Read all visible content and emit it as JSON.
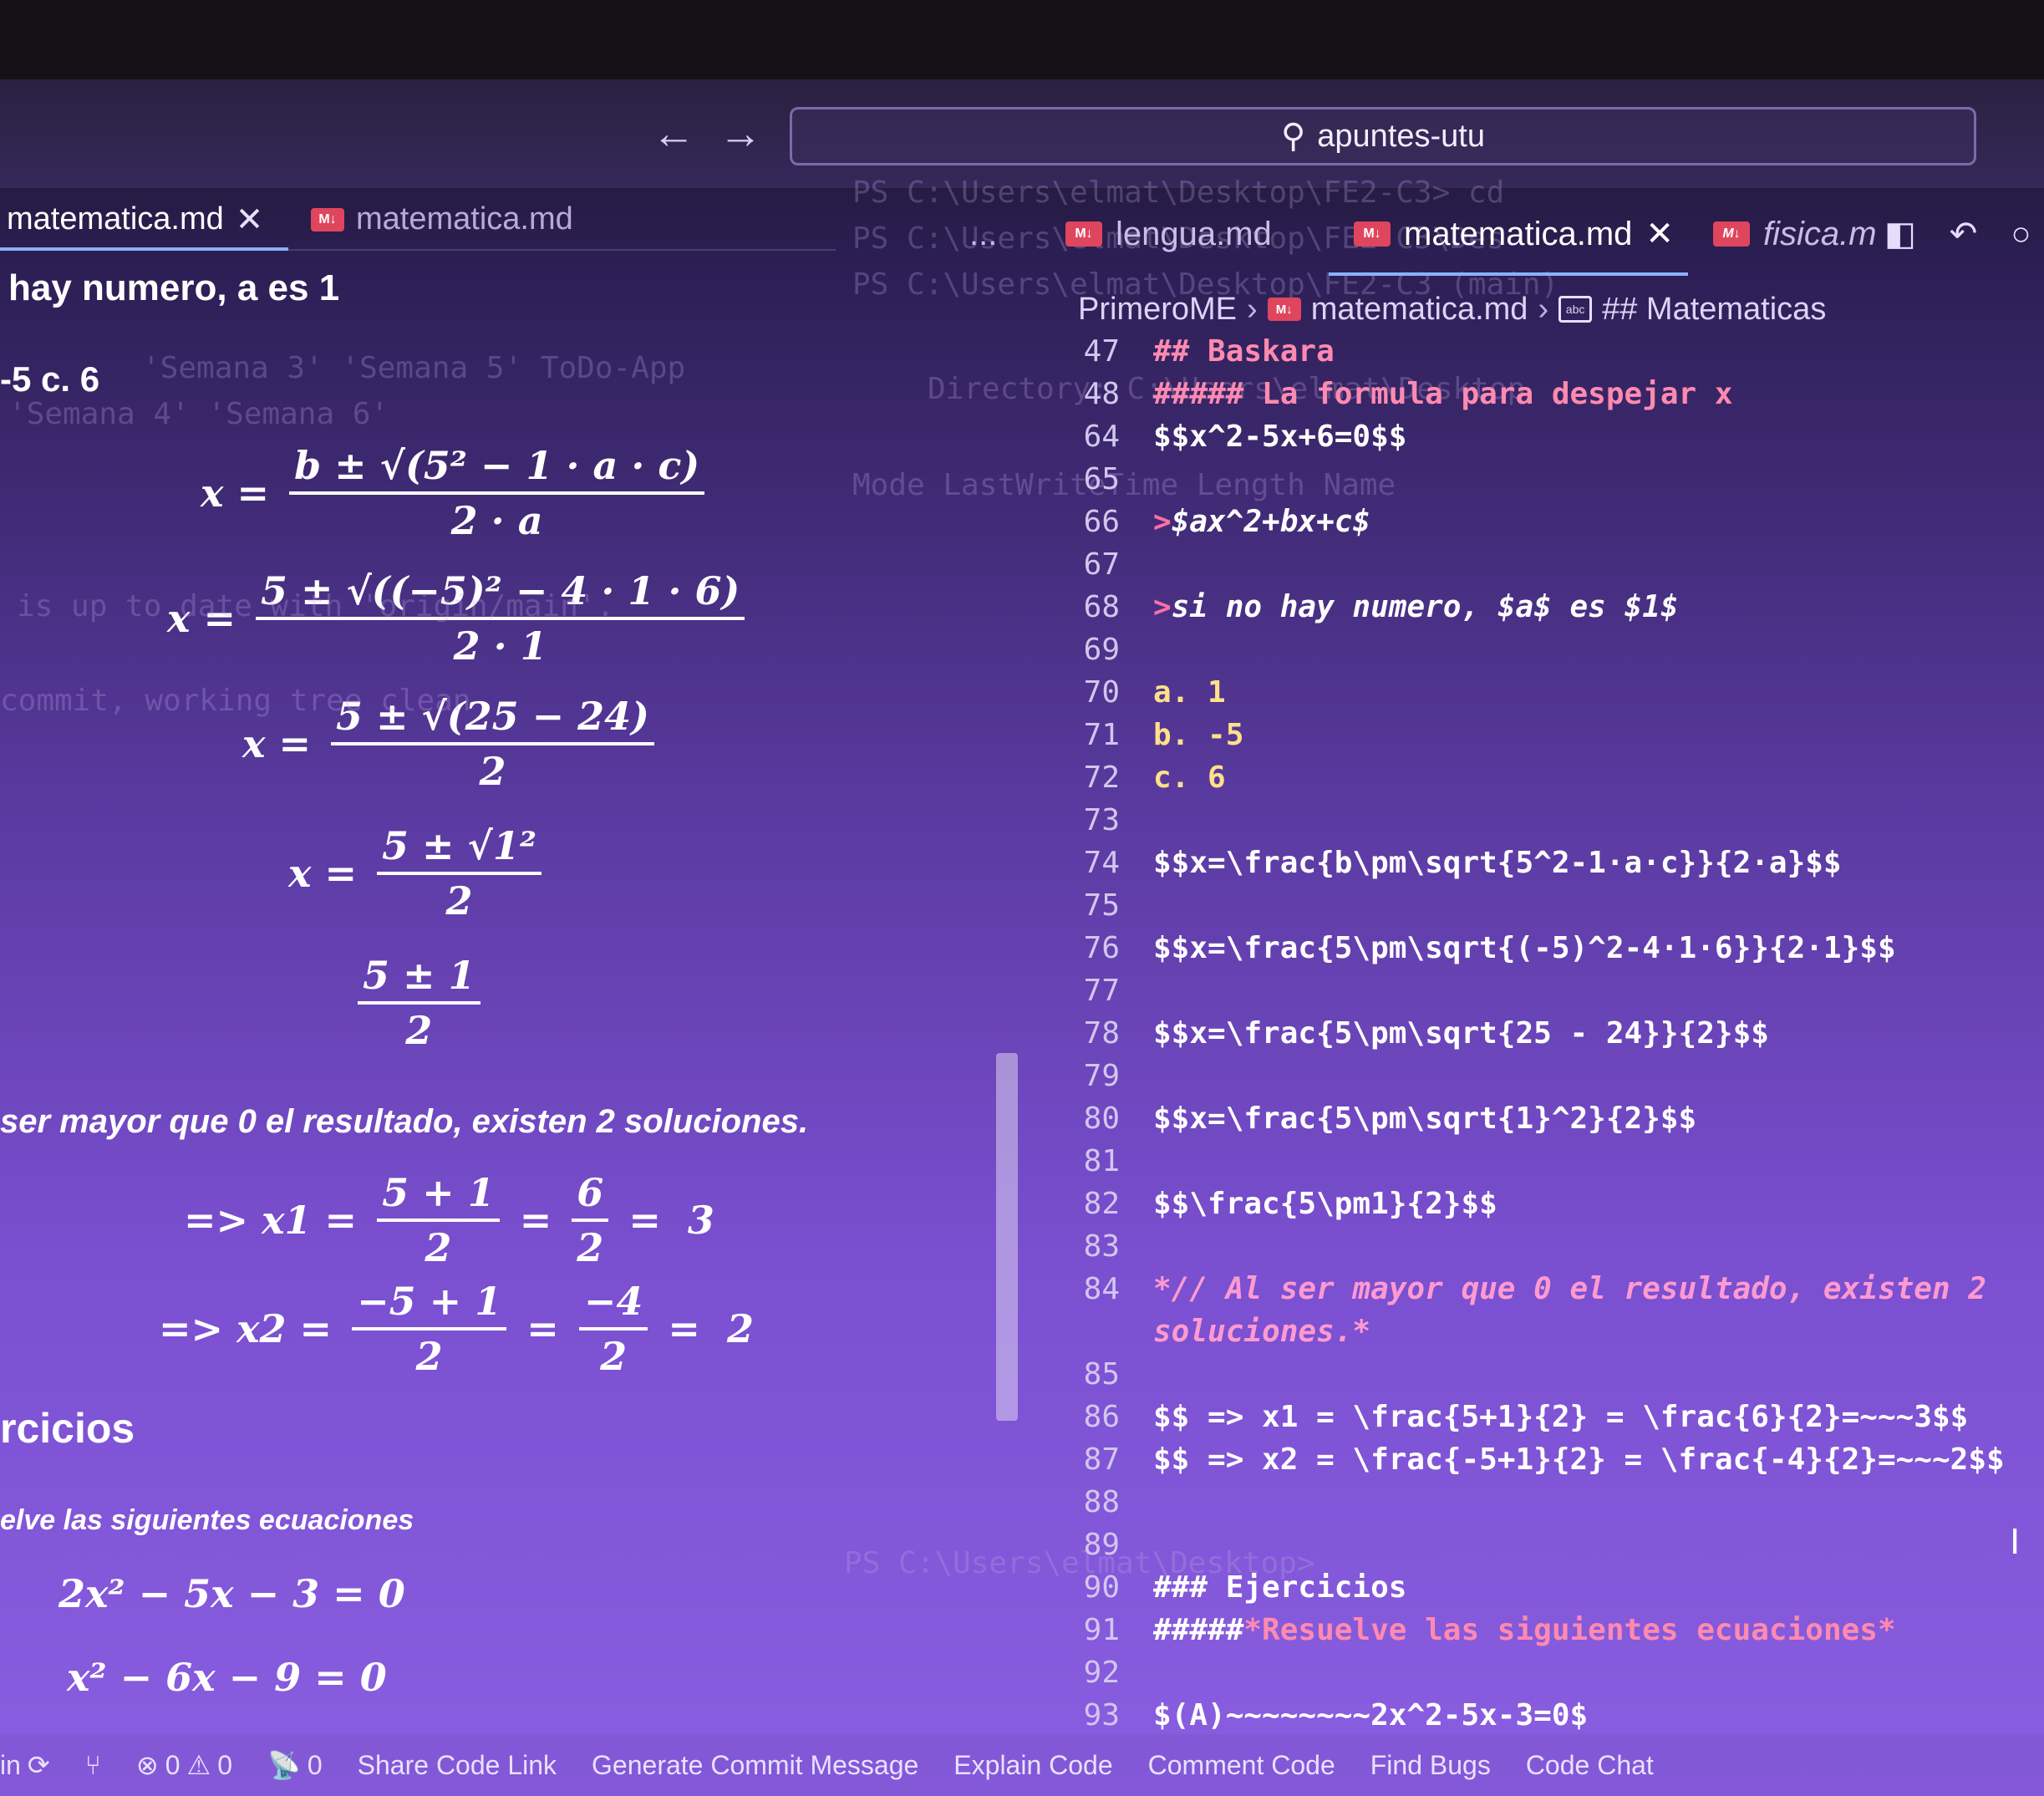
{
  "window": {
    "search": "apuntes-utu"
  },
  "left_pane": {
    "tabs": [
      {
        "label": "matematica.md",
        "active": true
      },
      {
        "label": "matematica.md",
        "active": false
      }
    ],
    "preview": {
      "line_a": "hay numero, a es 1",
      "line_c": "-5 c. 6",
      "eq1": {
        "lhs": "x =",
        "num": "b ± √(5² − 1 · a · c)",
        "den": "2 · a"
      },
      "eq2": {
        "lhs": "x =",
        "num": "5 ± √((−5)² − 4 · 1 · 6)",
        "den": "2 · 1"
      },
      "eq3": {
        "lhs": "x =",
        "num": "5 ± √(25 − 24)",
        "den": "2"
      },
      "eq4": {
        "lhs": "x =",
        "num": "5 ± √1²",
        "den": "2"
      },
      "eq5": {
        "num": "5 ± 1",
        "den": "2"
      },
      "statement": "ser mayor que 0 el resultado, existen 2 soluciones.",
      "sol1": {
        "prefix": "=> x1 =",
        "n1": "5 + 1",
        "d1": "2",
        "n2": "6",
        "d2": "2",
        "result": "3"
      },
      "sol2": {
        "prefix": "=> x2 =",
        "n1": "−5 + 1",
        "d1": "2",
        "n2": "−4",
        "d2": "2",
        "result": "2"
      },
      "section": "rcicios",
      "subtitle": "elve las siguientes ecuaciones",
      "ex1": "2x² − 5x − 3 = 0",
      "ex2": "x² − 6x − 9 = 0"
    }
  },
  "terminal_ghost": {
    "lines": [
      "PS C:\\Users\\elmat\\Desktop\\FE2-C3> cd",
      "PS C:\\Users\\elmat\\Desktop\\FE2-C3\\Des",
      "PS C:\\Users\\elmat\\Desktop\\FE2-C3 (main)",
      "'Semana 3'  'Semana 5'  ToDo-App",
      "'Semana 4'  'Semana 6'",
      "Directory: C:\\Users\\elmat\\Desktop",
      "Mode           LastWriteTime          Length Name",
      "is up to date with 'origin/main'.",
      "commit, working tree clean",
      "PS C:\\Users\\elmat\\Desktop>"
    ]
  },
  "right_editor": {
    "tabs": [
      {
        "label": "...",
        "kind": "overflow"
      },
      {
        "label": "lengua.md",
        "active": false
      },
      {
        "label": "matematica.md",
        "active": true
      },
      {
        "label": "fisica.m",
        "active": false
      }
    ],
    "breadcrumb": [
      "PrimeroME",
      "matematica.md",
      "## Matematicas"
    ],
    "lines": [
      {
        "n": "47",
        "parts": [
          {
            "t": "## Baskara",
            "c": "c-heading"
          }
        ]
      },
      {
        "n": "48",
        "parts": [
          {
            "t": "##### La formula para despejar x",
            "c": "c-heading"
          }
        ]
      },
      {
        "n": "64",
        "parts": [
          {
            "t": "$$x^2-5x+6=0$$",
            "c": "c-math"
          }
        ]
      },
      {
        "n": "65",
        "parts": []
      },
      {
        "n": "66",
        "parts": [
          {
            "t": "> ",
            "c": "c-quote"
          },
          {
            "t": "$ax^2+bx+c$",
            "c": "c-italic"
          }
        ]
      },
      {
        "n": "67",
        "parts": []
      },
      {
        "n": "68",
        "parts": [
          {
            "t": "> ",
            "c": "c-quote"
          },
          {
            "t": "si no hay numero, $a$ es $1$",
            "c": "c-italic"
          }
        ]
      },
      {
        "n": "69",
        "parts": []
      },
      {
        "n": "70",
        "parts": [
          {
            "t": "a. 1",
            "c": "c-list"
          }
        ]
      },
      {
        "n": "71",
        "parts": [
          {
            "t": "b. -5",
            "c": "c-list"
          }
        ]
      },
      {
        "n": "72",
        "parts": [
          {
            "t": "c. 6",
            "c": "c-list"
          }
        ]
      },
      {
        "n": "73",
        "parts": []
      },
      {
        "n": "74",
        "parts": [
          {
            "t": "$$x=\\frac{b\\pm\\sqrt{5^2-1·a·c}}{2·a}$$",
            "c": "c-math"
          }
        ]
      },
      {
        "n": "75",
        "parts": []
      },
      {
        "n": "76",
        "parts": [
          {
            "t": "$$x=\\frac{5\\pm\\sqrt{(-5)^2-4·1·6}}{2·1}$$",
            "c": "c-math"
          }
        ]
      },
      {
        "n": "77",
        "parts": []
      },
      {
        "n": "78",
        "parts": [
          {
            "t": "$$x=\\frac{5\\pm\\sqrt{25 - 24}}{2}$$",
            "c": "c-math"
          }
        ]
      },
      {
        "n": "79",
        "parts": []
      },
      {
        "n": "80",
        "parts": [
          {
            "t": "$$x=\\frac{5\\pm\\sqrt{1}^2}{2}$$",
            "c": "c-math"
          }
        ]
      },
      {
        "n": "81",
        "parts": []
      },
      {
        "n": "82",
        "parts": [
          {
            "t": "$$\\frac{5\\pm1}{2}$$",
            "c": "c-math"
          }
        ]
      },
      {
        "n": "83",
        "parts": []
      },
      {
        "n": "84",
        "parts": [
          {
            "t": "*// Al ser mayor que 0 el resultado, existen 2",
            "c": "c-comment"
          }
        ]
      },
      {
        "n": "",
        "parts": [
          {
            "t": "soluciones.*",
            "c": "c-comment"
          }
        ]
      },
      {
        "n": "85",
        "parts": []
      },
      {
        "n": "86",
        "parts": [
          {
            "t": "$$ => x1 = \\frac{5+1}{2} = \\frac{6}{2}=~~~3$$",
            "c": "c-math"
          }
        ]
      },
      {
        "n": "87",
        "parts": [
          {
            "t": "$$ => x2 = \\frac{-5+1}{2} = \\frac{-4}{2}=~~~2$$",
            "c": "c-math"
          }
        ]
      },
      {
        "n": "88",
        "parts": []
      },
      {
        "n": "89",
        "parts": []
      },
      {
        "n": "90",
        "parts": [
          {
            "t": "### Ejercicios",
            "c": "c-head"
          }
        ]
      },
      {
        "n": "91",
        "parts": [
          {
            "t": "##### ",
            "c": "c-head"
          },
          {
            "t": "*Resuelve las siguientes ecuaciones*",
            "c": "c-heading"
          }
        ]
      },
      {
        "n": "92",
        "parts": []
      },
      {
        "n": "93",
        "parts": [
          {
            "t": "$(A)~~~~~~~~2x^2-5x-3=0$",
            "c": "c-math"
          }
        ]
      }
    ]
  },
  "statusbar": {
    "branch": "in",
    "errors": "0",
    "warnings": "0",
    "ports": "0",
    "items": [
      "Share Code Link",
      "Generate Commit Message",
      "Explain Code",
      "Comment Code",
      "Find Bugs",
      "Code Chat"
    ]
  },
  "colors": {
    "accent": "#8ab0ff",
    "md_badge": "#e0455e",
    "heading_pink": "#ff8ab0"
  }
}
